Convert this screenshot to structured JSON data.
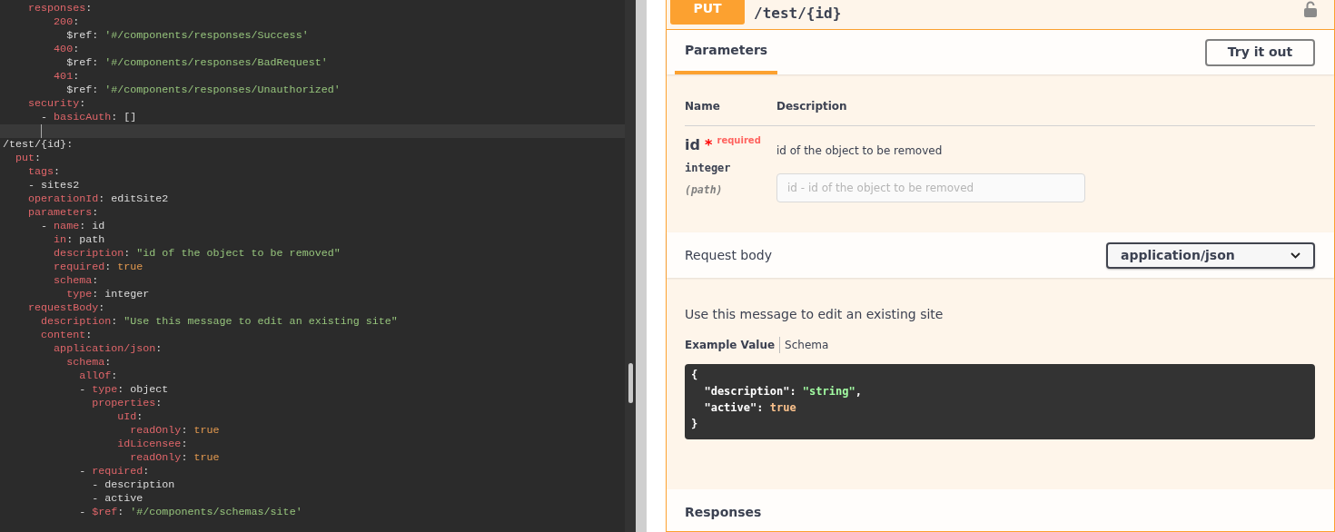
{
  "editor": {
    "lines": [
      {
        "current": false,
        "tokens": [
          {
            "text": "    responses",
            "kind": "key"
          },
          {
            "text": ":",
            "kind": "plain"
          }
        ]
      },
      {
        "current": false,
        "tokens": [
          {
            "text": "        200",
            "kind": "key"
          },
          {
            "text": ":",
            "kind": "plain"
          }
        ]
      },
      {
        "current": false,
        "tokens": [
          {
            "text": "          $ref: ",
            "kind": "plain"
          },
          {
            "text": "'#/components/responses/Success'",
            "kind": "string"
          }
        ]
      },
      {
        "current": false,
        "tokens": [
          {
            "text": "        400",
            "kind": "key"
          },
          {
            "text": ":",
            "kind": "plain"
          }
        ]
      },
      {
        "current": false,
        "tokens": [
          {
            "text": "          $ref: ",
            "kind": "plain"
          },
          {
            "text": "'#/components/responses/BadRequest'",
            "kind": "string"
          }
        ]
      },
      {
        "current": false,
        "tokens": [
          {
            "text": "        401",
            "kind": "key"
          },
          {
            "text": ":",
            "kind": "plain"
          }
        ]
      },
      {
        "current": false,
        "tokens": [
          {
            "text": "          $ref: ",
            "kind": "plain"
          },
          {
            "text": "'#/components/responses/Unauthorized'",
            "kind": "string"
          }
        ]
      },
      {
        "current": false,
        "tokens": [
          {
            "text": "    security",
            "kind": "key"
          },
          {
            "text": ":",
            "kind": "plain"
          }
        ]
      },
      {
        "current": false,
        "tokens": [
          {
            "text": "      - ",
            "kind": "plain"
          },
          {
            "text": "basicAuth",
            "kind": "key"
          },
          {
            "text": ": []",
            "kind": "plain"
          }
        ]
      },
      {
        "current": true
      },
      {
        "current": false,
        "tokens": [
          {
            "text": "/test/{id}:",
            "kind": "plain"
          }
        ]
      },
      {
        "current": false,
        "tokens": [
          {
            "text": "  put",
            "kind": "key"
          },
          {
            "text": ":",
            "kind": "plain"
          }
        ]
      },
      {
        "current": false,
        "tokens": [
          {
            "text": "    tags",
            "kind": "key"
          },
          {
            "text": ":",
            "kind": "plain"
          }
        ]
      },
      {
        "current": false,
        "tokens": [
          {
            "text": "    - sites2",
            "kind": "plain"
          }
        ]
      },
      {
        "current": false,
        "tokens": [
          {
            "text": "    operationId",
            "kind": "key"
          },
          {
            "text": ": editSite2",
            "kind": "plain"
          }
        ]
      },
      {
        "current": false,
        "tokens": [
          {
            "text": "    parameters",
            "kind": "key"
          },
          {
            "text": ":",
            "kind": "plain"
          }
        ]
      },
      {
        "current": false,
        "tokens": [
          {
            "text": "      - ",
            "kind": "plain"
          },
          {
            "text": "name",
            "kind": "key"
          },
          {
            "text": ": id",
            "kind": "plain"
          }
        ]
      },
      {
        "current": false,
        "tokens": [
          {
            "text": "        in",
            "kind": "key"
          },
          {
            "text": ": path",
            "kind": "plain"
          }
        ]
      },
      {
        "current": false,
        "tokens": [
          {
            "text": "        description",
            "kind": "key"
          },
          {
            "text": ": ",
            "kind": "plain"
          },
          {
            "text": "\"id of the object to be removed\"",
            "kind": "string"
          }
        ]
      },
      {
        "current": false,
        "tokens": [
          {
            "text": "        required",
            "kind": "key"
          },
          {
            "text": ": ",
            "kind": "plain"
          },
          {
            "text": "true",
            "kind": "bool"
          }
        ]
      },
      {
        "current": false,
        "tokens": [
          {
            "text": "        schema",
            "kind": "key"
          },
          {
            "text": ":",
            "kind": "plain"
          }
        ]
      },
      {
        "current": false,
        "tokens": [
          {
            "text": "          type",
            "kind": "key"
          },
          {
            "text": ": integer",
            "kind": "plain"
          }
        ]
      },
      {
        "current": false,
        "tokens": [
          {
            "text": "    requestBody",
            "kind": "key"
          },
          {
            "text": ":",
            "kind": "plain"
          }
        ]
      },
      {
        "current": false,
        "tokens": [
          {
            "text": "      description",
            "kind": "key"
          },
          {
            "text": ": ",
            "kind": "plain"
          },
          {
            "text": "\"Use this message to edit an existing site\"",
            "kind": "string"
          }
        ]
      },
      {
        "current": false,
        "tokens": [
          {
            "text": "      content",
            "kind": "key"
          },
          {
            "text": ":",
            "kind": "plain"
          }
        ]
      },
      {
        "current": false,
        "tokens": [
          {
            "text": "        application/json",
            "kind": "key"
          },
          {
            "text": ":",
            "kind": "plain"
          }
        ]
      },
      {
        "current": false,
        "tokens": [
          {
            "text": "          schema",
            "kind": "key"
          },
          {
            "text": ":",
            "kind": "plain"
          }
        ]
      },
      {
        "current": false,
        "tokens": [
          {
            "text": "            allOf",
            "kind": "key"
          },
          {
            "text": ":",
            "kind": "plain"
          }
        ]
      },
      {
        "current": false,
        "tokens": [
          {
            "text": "            - ",
            "kind": "plain"
          },
          {
            "text": "type",
            "kind": "key"
          },
          {
            "text": ": object",
            "kind": "plain"
          }
        ]
      },
      {
        "current": false,
        "tokens": [
          {
            "text": "              properties",
            "kind": "key"
          },
          {
            "text": ":",
            "kind": "plain"
          }
        ]
      },
      {
        "current": false,
        "tokens": [
          {
            "text": "                  uId",
            "kind": "key"
          },
          {
            "text": ":",
            "kind": "plain"
          }
        ]
      },
      {
        "current": false,
        "tokens": [
          {
            "text": "                    readOnly",
            "kind": "key"
          },
          {
            "text": ": ",
            "kind": "plain"
          },
          {
            "text": "true",
            "kind": "bool"
          }
        ]
      },
      {
        "current": false,
        "tokens": [
          {
            "text": "                  idLicensee",
            "kind": "key"
          },
          {
            "text": ":",
            "kind": "plain"
          }
        ]
      },
      {
        "current": false,
        "tokens": [
          {
            "text": "                    readOnly",
            "kind": "key"
          },
          {
            "text": ": ",
            "kind": "plain"
          },
          {
            "text": "true",
            "kind": "bool"
          }
        ]
      },
      {
        "current": false,
        "tokens": [
          {
            "text": "            - ",
            "kind": "plain"
          },
          {
            "text": "required",
            "kind": "key"
          },
          {
            "text": ":",
            "kind": "plain"
          }
        ]
      },
      {
        "current": false,
        "tokens": [
          {
            "text": "              - description",
            "kind": "plain"
          }
        ]
      },
      {
        "current": false,
        "tokens": [
          {
            "text": "              - active",
            "kind": "plain"
          }
        ]
      },
      {
        "current": false,
        "tokens": [
          {
            "text": "            - ",
            "kind": "plain"
          },
          {
            "text": "$ref",
            "kind": "key"
          },
          {
            "text": ": ",
            "kind": "plain"
          },
          {
            "text": "'#/components/schemas/site'",
            "kind": "string"
          }
        ]
      }
    ]
  },
  "operation": {
    "method": "PUT",
    "path": "/test/{id}",
    "tabs": [
      {
        "label": "Parameters",
        "selected": true
      }
    ],
    "try_button": "Try it out",
    "parameters": {
      "columns": [
        "Name",
        "Description"
      ],
      "rows": [
        {
          "name": "id",
          "required": true,
          "required_mark": "*",
          "required_label": "required",
          "type": "integer",
          "location": "(path)",
          "description": "id of the object to be removed",
          "placeholder": "id - id of the object to be removed"
        }
      ]
    },
    "request_body": {
      "title": "Request body",
      "content_type": "application/json",
      "description": "Use this message to edit an existing site",
      "views": [
        {
          "label": "Example Value",
          "selected": true
        },
        {
          "label": "Schema",
          "selected": false
        }
      ],
      "example": [
        [
          {
            "text": "{",
            "kind": "plain"
          }
        ],
        [
          {
            "text": "  \"description\"",
            "kind": "plain"
          },
          {
            "text": ": ",
            "kind": "plain"
          },
          {
            "text": "\"string\"",
            "kind": "string"
          },
          {
            "text": ",",
            "kind": "plain"
          }
        ],
        [
          {
            "text": "  \"active\"",
            "kind": "plain"
          },
          {
            "text": ": ",
            "kind": "plain"
          },
          {
            "text": "true",
            "kind": "bool"
          }
        ],
        [
          {
            "text": "}",
            "kind": "plain"
          }
        ]
      ]
    },
    "responses": {
      "title": "Responses"
    }
  }
}
